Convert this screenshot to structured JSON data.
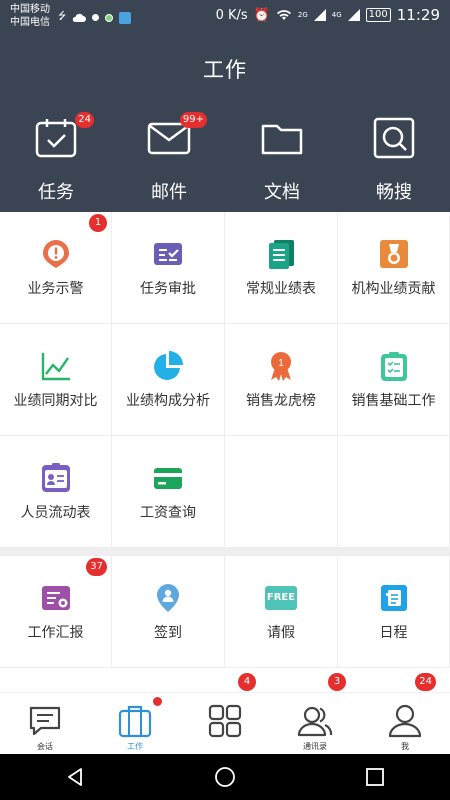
{
  "status": {
    "carrier1": "中国移动",
    "carrier2": "中国电信",
    "net_speed": "0 K/s",
    "signal1": "2G",
    "signal2": "4G",
    "battery": "100",
    "time": "11:29"
  },
  "header": {
    "title": "工作",
    "quick": [
      {
        "label": "任务",
        "icon": "calendar-check-icon",
        "badge": "24"
      },
      {
        "label": "邮件",
        "icon": "mail-icon",
        "badge": "99+"
      },
      {
        "label": "文档",
        "icon": "folder-icon",
        "badge": ""
      },
      {
        "label": "畅搜",
        "icon": "search-icon",
        "badge": ""
      }
    ]
  },
  "apps": [
    {
      "label": "业务示警",
      "icon": "alert-icon",
      "color": "#e8704a",
      "badge": "1"
    },
    {
      "label": "任务审批",
      "icon": "approval-icon",
      "color": "#6b5fb5",
      "badge": ""
    },
    {
      "label": "常规业绩表",
      "icon": "document-icon",
      "color": "#1aa589",
      "badge": ""
    },
    {
      "label": "机构业绩贡献",
      "icon": "medal-icon",
      "color": "#e88a3a",
      "badge": ""
    },
    {
      "label": "业绩同期对比",
      "icon": "line-chart-icon",
      "color": "#27b36b",
      "badge": ""
    },
    {
      "label": "业绩构成分析",
      "icon": "pie-chart-icon",
      "color": "#22b0e6",
      "badge": ""
    },
    {
      "label": "销售龙虎榜",
      "icon": "ribbon-icon",
      "color": "#ec6a3a",
      "badge": ""
    },
    {
      "label": "销售基础工作",
      "icon": "clipboard-icon",
      "color": "#3cc79d",
      "badge": ""
    },
    {
      "label": "人员流动表",
      "icon": "id-card-icon",
      "color": "#7a5ec4",
      "badge": ""
    },
    {
      "label": "工资查询",
      "icon": "card-icon",
      "color": "#1aa55a",
      "badge": ""
    }
  ],
  "apps2": [
    {
      "label": "工作汇报",
      "icon": "report-icon",
      "color": "#a04fa8",
      "badge": "37"
    },
    {
      "label": "签到",
      "icon": "location-icon",
      "color": "#5fa8df",
      "badge": ""
    },
    {
      "label": "请假",
      "icon": "free-icon",
      "color": "#4fc3b8",
      "badge": "",
      "text": "FREE"
    },
    {
      "label": "日程",
      "icon": "schedule-icon",
      "color": "#1fa3e6",
      "badge": ""
    }
  ],
  "tabs": [
    {
      "label": "会话",
      "icon": "chat-icon",
      "badge": ""
    },
    {
      "label": "工作",
      "icon": "briefcase-icon",
      "badge": "",
      "dot": true
    },
    {
      "label": "",
      "icon": "apps-grid-icon",
      "badge": "4"
    },
    {
      "label": "通讯录",
      "icon": "contacts-icon",
      "badge": "3"
    },
    {
      "label": "我",
      "icon": "me-icon",
      "badge": "24"
    }
  ]
}
